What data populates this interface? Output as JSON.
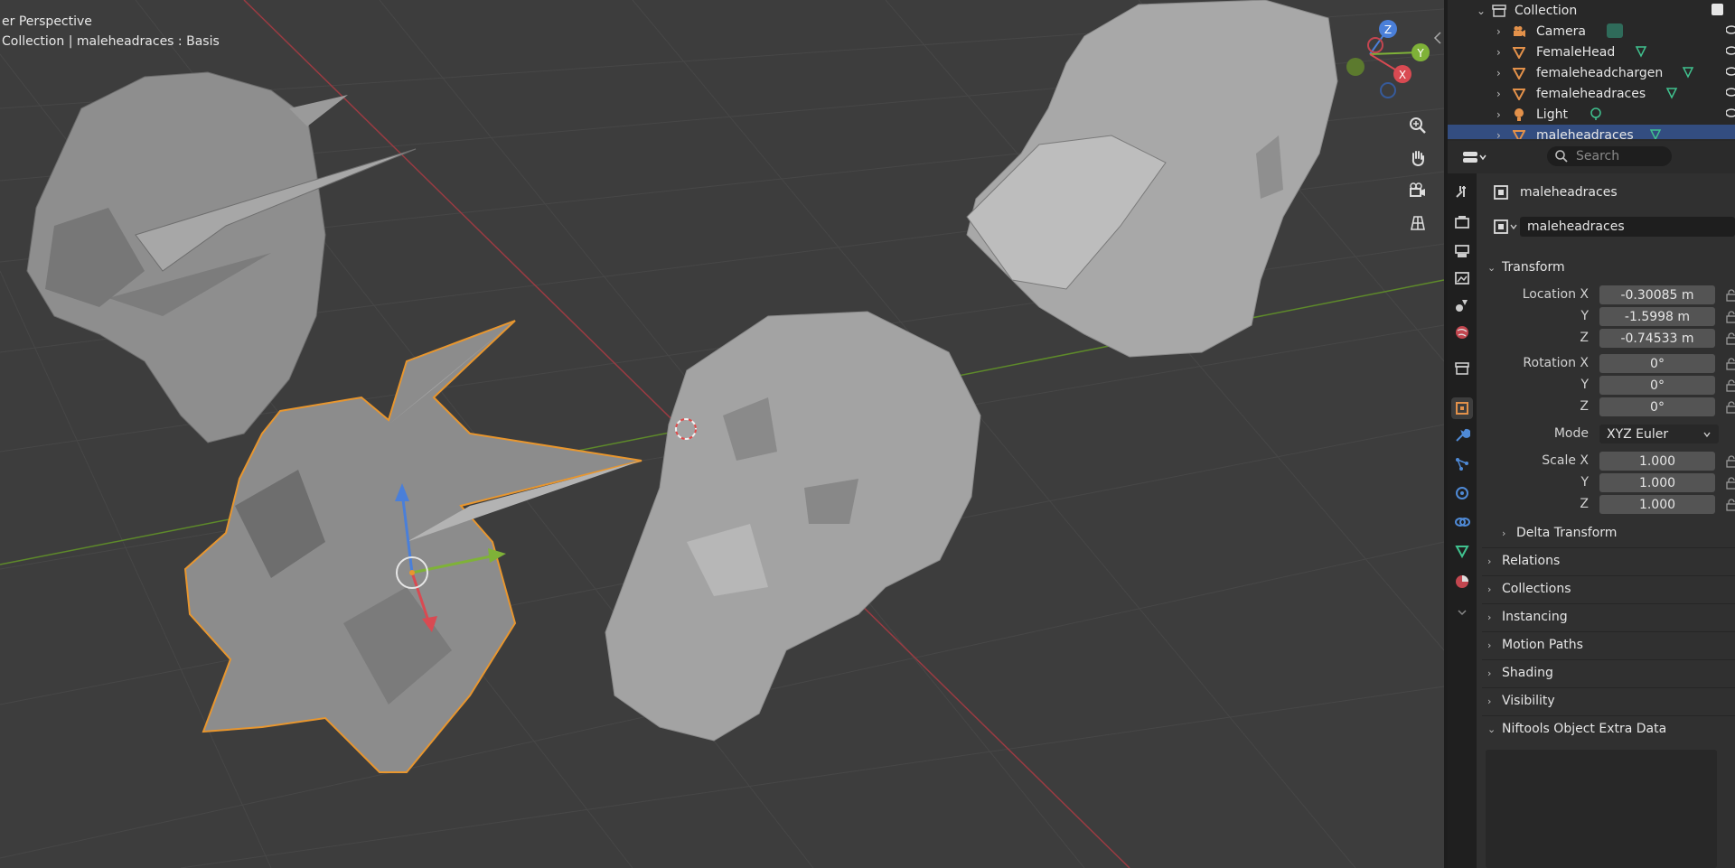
{
  "viewport": {
    "perspective_label": "er Perspective",
    "context_label": "Collection | maleheadraces : Basis",
    "gizmo": {
      "z": "Z",
      "y": "Y",
      "x": "X"
    },
    "nav_buttons": [
      "zoom-icon",
      "hand-icon",
      "camera-icon",
      "grid-icon"
    ]
  },
  "outliner": {
    "collection": "Collection",
    "items": [
      {
        "label": "Camera",
        "icon": "camera-icon",
        "data_icon": "camera-data-icon"
      },
      {
        "label": "FemaleHead",
        "icon": "mesh-icon",
        "data_icon": "mesh-data-icon"
      },
      {
        "label": "femaleheadchargen",
        "icon": "mesh-icon",
        "data_icon": "mesh-data-icon"
      },
      {
        "label": "femaleheadraces",
        "icon": "mesh-icon",
        "data_icon": "mesh-data-icon"
      },
      {
        "label": "Light",
        "icon": "light-icon",
        "data_icon": "light-data-icon"
      },
      {
        "label": "maleheadraces",
        "icon": "mesh-icon",
        "data_icon": "mesh-data-icon"
      }
    ]
  },
  "properties": {
    "search_placeholder": "Search",
    "object_title": "maleheadraces",
    "object_name_field": "maleheadraces",
    "transform": {
      "header": "Transform",
      "location_label": "Location X",
      "location": [
        "-0.30085 m",
        "-1.5998 m",
        "-0.74533 m"
      ],
      "rotation_label": "Rotation X",
      "rotation": [
        "0°",
        "0°",
        "0°"
      ],
      "mode_label": "Mode",
      "mode_value": "XYZ Euler",
      "scale_label": "Scale X",
      "scale": [
        "1.000",
        "1.000",
        "1.000"
      ],
      "axis_y": "Y",
      "axis_z": "Z",
      "delta": "Delta Transform"
    },
    "panels": [
      "Relations",
      "Collections",
      "Instancing",
      "Motion Paths",
      "Shading",
      "Visibility"
    ],
    "niftools": "Niftools Object Extra Data"
  },
  "colors": {
    "accent_blue": "#334d80",
    "selection_orange": "#e8962e",
    "axis_red": "#d94a52",
    "axis_green": "#7fb238",
    "axis_blue": "#4a7fd9"
  }
}
